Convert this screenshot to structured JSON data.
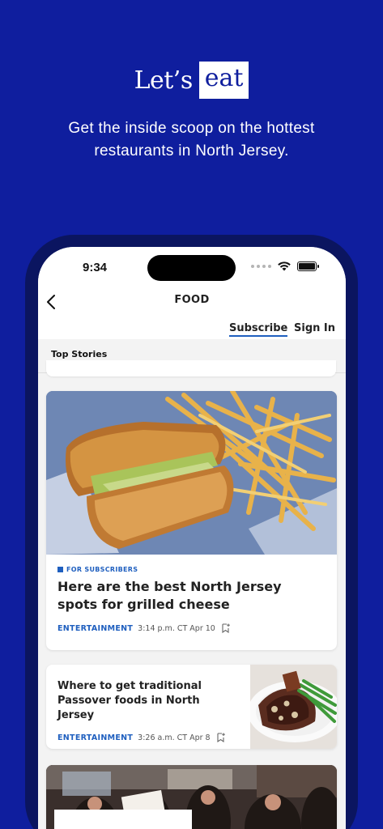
{
  "promo": {
    "title_word1": "Let’s",
    "title_word2": "eat",
    "subtitle": "Get the inside scoop on the hottest restaurants in North Jersey."
  },
  "status_bar": {
    "time": "9:34"
  },
  "nav": {
    "back_icon": "chevron-left-icon",
    "title": "FOOD"
  },
  "account": {
    "subscribe_label": "Subscribe",
    "signin_label": "Sign In"
  },
  "tabs": [
    {
      "label": "Top Stories",
      "active": true
    }
  ],
  "stories": [
    {
      "badge": "FOR SUBSCRIBERS",
      "headline": "Here are the best North Jersey spots for grilled cheese",
      "category": "ENTERTAINMENT",
      "timestamp": "3:14 p.m. CT Apr 10"
    },
    {
      "headline": "Where to get traditional Passover foods in North Jersey",
      "category": "ENTERTAINMENT",
      "timestamp": "3:26 a.m. CT Apr 8"
    }
  ],
  "colors": {
    "background": "#0f1e9e",
    "accent": "#1f5fbf"
  }
}
